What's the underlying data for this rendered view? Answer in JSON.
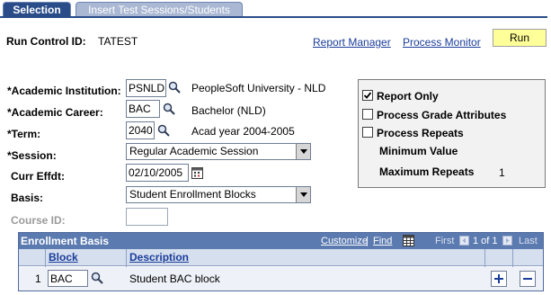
{
  "tabs": [
    {
      "label": "Selection"
    },
    {
      "label": "Insert Test Sessions/Students"
    }
  ],
  "header": {
    "run_control_label": "Run Control ID:",
    "run_control_value": "TATEST",
    "report_manager_link": "Report Manager",
    "process_monitor_link": "Process Monitor",
    "run_button": "Run"
  },
  "form": {
    "institution": {
      "label": "*Academic Institution:",
      "value": "PSNLD",
      "description": "PeopleSoft University - NLD"
    },
    "career": {
      "label": "*Academic Career:",
      "value": "BAC",
      "description": "Bachelor (NLD)"
    },
    "term": {
      "label": "*Term:",
      "value": "2040",
      "description": "Acad year 2004-2005"
    },
    "session": {
      "label": "*Session:",
      "value": "Regular Academic Session"
    },
    "curr_effdt": {
      "label": "Curr Effdt:",
      "value": "02/10/2005"
    },
    "basis": {
      "label": "Basis:",
      "value": "Student Enrollment Blocks"
    },
    "course_id": {
      "label": "Course ID:",
      "value": ""
    }
  },
  "options": {
    "report_only": {
      "label": "Report Only",
      "checked": true
    },
    "process_grade_attributes": {
      "label": "Process Grade Attributes",
      "checked": false
    },
    "process_repeats": {
      "label": "Process Repeats",
      "checked": false
    },
    "minimum_value_label": "Minimum Value",
    "maximum_repeats_label": "Maximum Repeats",
    "maximum_repeats_value": "1"
  },
  "grid": {
    "title": "Enrollment Basis",
    "customize": "Customize",
    "find": "Find",
    "sep": "|",
    "first": "First",
    "range": "1 of 1",
    "last": "Last",
    "columns": {
      "block": "Block",
      "description": "Description"
    },
    "rows": [
      {
        "num": "1",
        "block": "BAC",
        "description": "Student BAC block"
      }
    ]
  },
  "colors": {
    "tab_active": "#2a4d8a",
    "tab_inactive": "#aab8d3",
    "link": "#1a3d9a",
    "run_button_bg": "#ffff99",
    "grid_header": "#5b7ab0",
    "grid_col_header": "#d6dfee"
  },
  "icons": {
    "lookup": "magnifier-icon",
    "calendar": "calendar-icon",
    "grid_view_all": "grid-icon",
    "add_row": "plus-icon",
    "delete_row": "minus-icon"
  }
}
